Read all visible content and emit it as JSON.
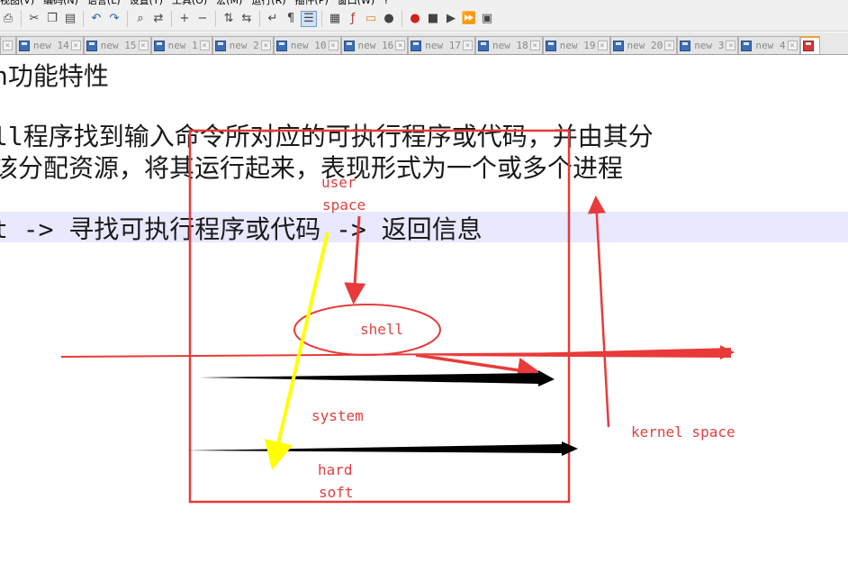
{
  "menubar": {
    "items": [
      "视图(V)",
      "编码(N)",
      "语言(L)",
      "设置(T)",
      "工具(O)",
      "宏(M)",
      "运行(R)",
      "插件(P)",
      "窗口(W)",
      "?"
    ]
  },
  "toolbar": {
    "icons": [
      "print-icon",
      "cut-icon",
      "copy-icon",
      "paste-icon",
      "undo-icon",
      "redo-icon",
      "find-icon",
      "replace-icon",
      "zoom-in-icon",
      "zoom-out-icon",
      "sync-vertical-icon",
      "sync-horizontal-icon",
      "word-wrap-icon",
      "show-all-chars-icon",
      "indent-guide-icon",
      "document-map-icon",
      "function-list-icon",
      "folder-icon",
      "monitor-icon",
      "record-macro-icon",
      "stop-macro-icon",
      "play-macro-icon",
      "run-macro-multiple-icon",
      "save-macro-icon"
    ]
  },
  "tabs": [
    {
      "label": "",
      "partial": true
    },
    {
      "label": "new 14"
    },
    {
      "label": "new 15"
    },
    {
      "label": "new 1"
    },
    {
      "label": "new 2"
    },
    {
      "label": "new 10"
    },
    {
      "label": "new 16"
    },
    {
      "label": "new 17"
    },
    {
      "label": "new 18"
    },
    {
      "label": "new 19"
    },
    {
      "label": "new 20"
    },
    {
      "label": "new 3"
    },
    {
      "label": "new 4"
    },
    {
      "label": "",
      "active": true,
      "partial": true
    }
  ],
  "editor": {
    "lines": [
      "h功能特性",
      "",
      "ll程序找到输入命令所对应的可执行程序或代码，并由其分",
      "该分配资源，将其运行起来，表现形式为一个或多个进程",
      "",
      "t -> 寻找可执行程序或代码 -> 返回信息"
    ]
  },
  "diagram": {
    "labels": {
      "user": "user",
      "space": "space",
      "shell": "shell",
      "system": "system",
      "hard": "hard",
      "soft": "soft",
      "kernel": "kernel space"
    },
    "colors": {
      "red": "#e83a3a",
      "black": "#000000",
      "yellow": "#ffff00"
    }
  }
}
